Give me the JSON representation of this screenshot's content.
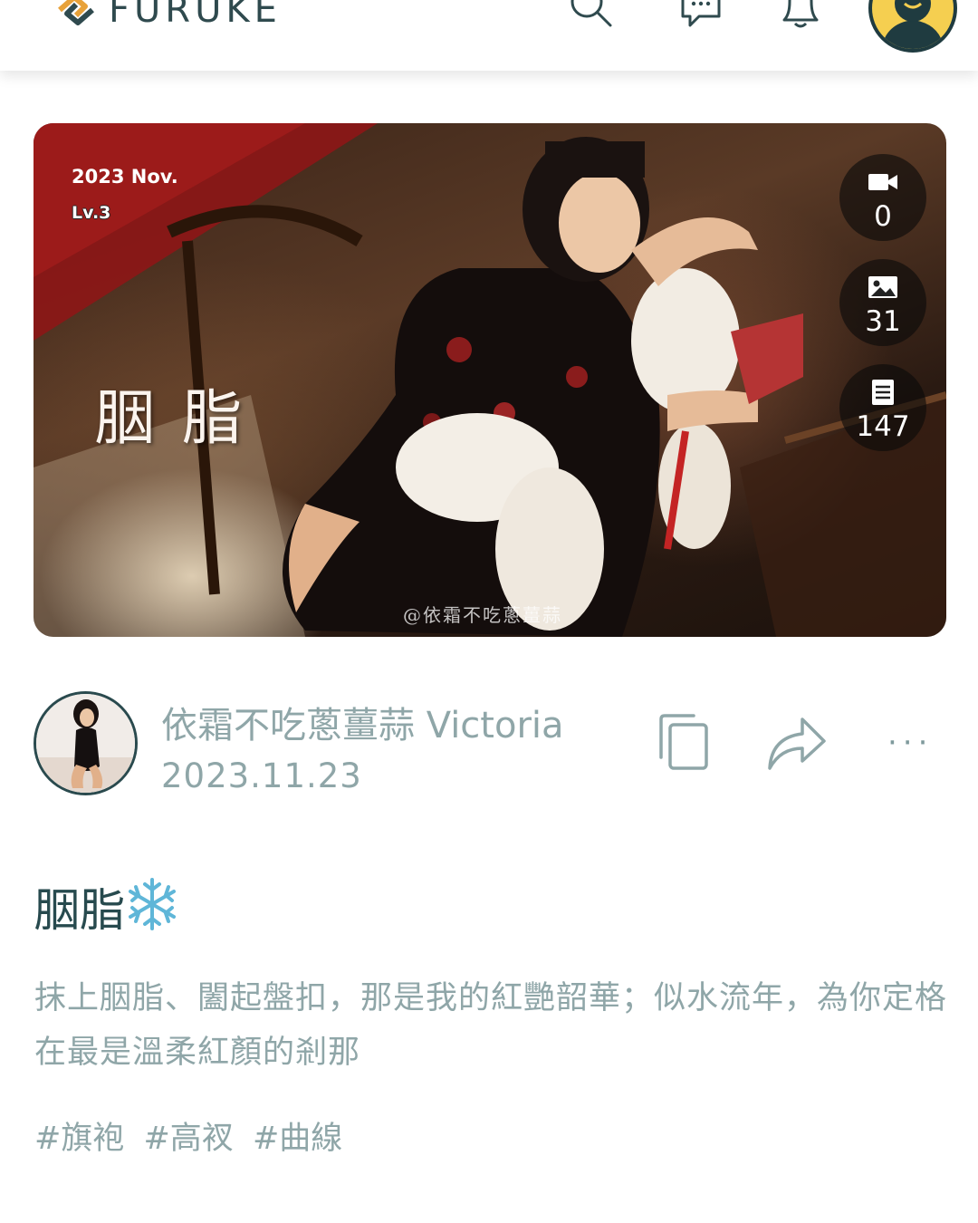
{
  "header": {
    "brand": "FURUKE",
    "icons": [
      "search-icon",
      "chat-icon",
      "bell-icon",
      "user-avatar"
    ]
  },
  "cover": {
    "date": "2023 Nov.",
    "level": "Lv.3",
    "title": "胭脂",
    "watermark": "@依霜不吃蔥薑蒜",
    "stats": {
      "videos": "0",
      "images": "31",
      "posts": "147"
    }
  },
  "author": {
    "name": "依霜不吃蔥薑蒜 Victoria",
    "date": "2023.11.23",
    "more_label": "···"
  },
  "post": {
    "title": "胭脂",
    "title_emoji": "snowflake",
    "text": "抹上胭脂、闔起盤扣，那是我的紅艷韶華；似水流年，為你定格在最是溫柔紅顏的剎那",
    "tags": [
      "#旗袍",
      "#高衩",
      "#曲線"
    ]
  },
  "colors": {
    "brand_dark": "#2f4a4e",
    "muted_text": "#8fa6a8",
    "title_text": "#274a4e",
    "avatar_yellow": "#f5cf50",
    "logo_orange": "#e8a23a"
  }
}
